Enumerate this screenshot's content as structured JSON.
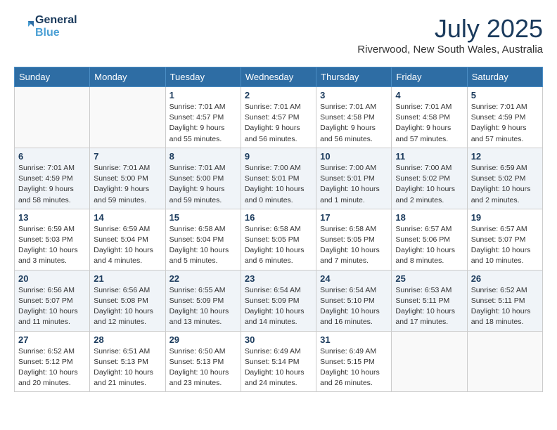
{
  "header": {
    "logo_line1": "General",
    "logo_line2": "Blue",
    "month_year": "July 2025",
    "location": "Riverwood, New South Wales, Australia"
  },
  "columns": [
    "Sunday",
    "Monday",
    "Tuesday",
    "Wednesday",
    "Thursday",
    "Friday",
    "Saturday"
  ],
  "weeks": [
    [
      {
        "day": "",
        "info": ""
      },
      {
        "day": "",
        "info": ""
      },
      {
        "day": "1",
        "info": "Sunrise: 7:01 AM\nSunset: 4:57 PM\nDaylight: 9 hours and 55 minutes."
      },
      {
        "day": "2",
        "info": "Sunrise: 7:01 AM\nSunset: 4:57 PM\nDaylight: 9 hours and 56 minutes."
      },
      {
        "day": "3",
        "info": "Sunrise: 7:01 AM\nSunset: 4:58 PM\nDaylight: 9 hours and 56 minutes."
      },
      {
        "day": "4",
        "info": "Sunrise: 7:01 AM\nSunset: 4:58 PM\nDaylight: 9 hours and 57 minutes."
      },
      {
        "day": "5",
        "info": "Sunrise: 7:01 AM\nSunset: 4:59 PM\nDaylight: 9 hours and 57 minutes."
      }
    ],
    [
      {
        "day": "6",
        "info": "Sunrise: 7:01 AM\nSunset: 4:59 PM\nDaylight: 9 hours and 58 minutes."
      },
      {
        "day": "7",
        "info": "Sunrise: 7:01 AM\nSunset: 5:00 PM\nDaylight: 9 hours and 59 minutes."
      },
      {
        "day": "8",
        "info": "Sunrise: 7:01 AM\nSunset: 5:00 PM\nDaylight: 9 hours and 59 minutes."
      },
      {
        "day": "9",
        "info": "Sunrise: 7:00 AM\nSunset: 5:01 PM\nDaylight: 10 hours and 0 minutes."
      },
      {
        "day": "10",
        "info": "Sunrise: 7:00 AM\nSunset: 5:01 PM\nDaylight: 10 hours and 1 minute."
      },
      {
        "day": "11",
        "info": "Sunrise: 7:00 AM\nSunset: 5:02 PM\nDaylight: 10 hours and 2 minutes."
      },
      {
        "day": "12",
        "info": "Sunrise: 6:59 AM\nSunset: 5:02 PM\nDaylight: 10 hours and 2 minutes."
      }
    ],
    [
      {
        "day": "13",
        "info": "Sunrise: 6:59 AM\nSunset: 5:03 PM\nDaylight: 10 hours and 3 minutes."
      },
      {
        "day": "14",
        "info": "Sunrise: 6:59 AM\nSunset: 5:04 PM\nDaylight: 10 hours and 4 minutes."
      },
      {
        "day": "15",
        "info": "Sunrise: 6:58 AM\nSunset: 5:04 PM\nDaylight: 10 hours and 5 minutes."
      },
      {
        "day": "16",
        "info": "Sunrise: 6:58 AM\nSunset: 5:05 PM\nDaylight: 10 hours and 6 minutes."
      },
      {
        "day": "17",
        "info": "Sunrise: 6:58 AM\nSunset: 5:05 PM\nDaylight: 10 hours and 7 minutes."
      },
      {
        "day": "18",
        "info": "Sunrise: 6:57 AM\nSunset: 5:06 PM\nDaylight: 10 hours and 8 minutes."
      },
      {
        "day": "19",
        "info": "Sunrise: 6:57 AM\nSunset: 5:07 PM\nDaylight: 10 hours and 10 minutes."
      }
    ],
    [
      {
        "day": "20",
        "info": "Sunrise: 6:56 AM\nSunset: 5:07 PM\nDaylight: 10 hours and 11 minutes."
      },
      {
        "day": "21",
        "info": "Sunrise: 6:56 AM\nSunset: 5:08 PM\nDaylight: 10 hours and 12 minutes."
      },
      {
        "day": "22",
        "info": "Sunrise: 6:55 AM\nSunset: 5:09 PM\nDaylight: 10 hours and 13 minutes."
      },
      {
        "day": "23",
        "info": "Sunrise: 6:54 AM\nSunset: 5:09 PM\nDaylight: 10 hours and 14 minutes."
      },
      {
        "day": "24",
        "info": "Sunrise: 6:54 AM\nSunset: 5:10 PM\nDaylight: 10 hours and 16 minutes."
      },
      {
        "day": "25",
        "info": "Sunrise: 6:53 AM\nSunset: 5:11 PM\nDaylight: 10 hours and 17 minutes."
      },
      {
        "day": "26",
        "info": "Sunrise: 6:52 AM\nSunset: 5:11 PM\nDaylight: 10 hours and 18 minutes."
      }
    ],
    [
      {
        "day": "27",
        "info": "Sunrise: 6:52 AM\nSunset: 5:12 PM\nDaylight: 10 hours and 20 minutes."
      },
      {
        "day": "28",
        "info": "Sunrise: 6:51 AM\nSunset: 5:13 PM\nDaylight: 10 hours and 21 minutes."
      },
      {
        "day": "29",
        "info": "Sunrise: 6:50 AM\nSunset: 5:13 PM\nDaylight: 10 hours and 23 minutes."
      },
      {
        "day": "30",
        "info": "Sunrise: 6:49 AM\nSunset: 5:14 PM\nDaylight: 10 hours and 24 minutes."
      },
      {
        "day": "31",
        "info": "Sunrise: 6:49 AM\nSunset: 5:15 PM\nDaylight: 10 hours and 26 minutes."
      },
      {
        "day": "",
        "info": ""
      },
      {
        "day": "",
        "info": ""
      }
    ]
  ]
}
